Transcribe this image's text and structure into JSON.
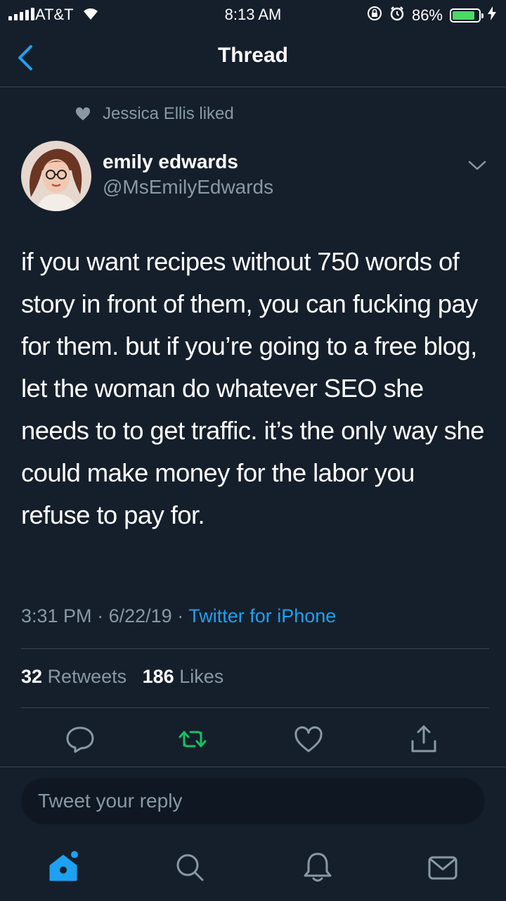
{
  "status_bar": {
    "carrier": "AT&T",
    "time": "8:13 AM",
    "battery_percent": "86%",
    "battery_level": 0.86
  },
  "nav": {
    "title": "Thread"
  },
  "social_context": {
    "text": "Jessica Ellis liked"
  },
  "tweet": {
    "author_name": "emily edwards",
    "author_handle": "@MsEmilyEdwards",
    "text": "if you want recipes without 750 words of story in front of them, you can fucking pay for them. but if you’re going to a free blog, let the woman do whatever SEO she needs to to get traffic. it’s the only way she could make money for the labor you refuse to pay for.",
    "time": "3:31 PM",
    "date": "6/22/19",
    "separator": "·",
    "source": "Twitter for iPhone",
    "retweets_count": "32",
    "retweets_label": "Retweets",
    "likes_count": "186",
    "likes_label": "Likes"
  },
  "reply": {
    "placeholder": "Tweet your reply"
  },
  "colors": {
    "background": "#151f2b",
    "accent": "#1da1f2",
    "retweet": "#17bf63",
    "muted": "#8899a6",
    "divider": "#38444d"
  },
  "icons": {
    "back": "chevron-left-icon",
    "liked": "heart-icon",
    "caret": "chevron-down-icon",
    "reply": "reply-icon",
    "retweet": "retweet-icon",
    "like": "heart-icon",
    "share": "share-icon",
    "home": "home-icon",
    "search": "search-icon",
    "notifications": "bell-icon",
    "messages": "mail-icon"
  }
}
